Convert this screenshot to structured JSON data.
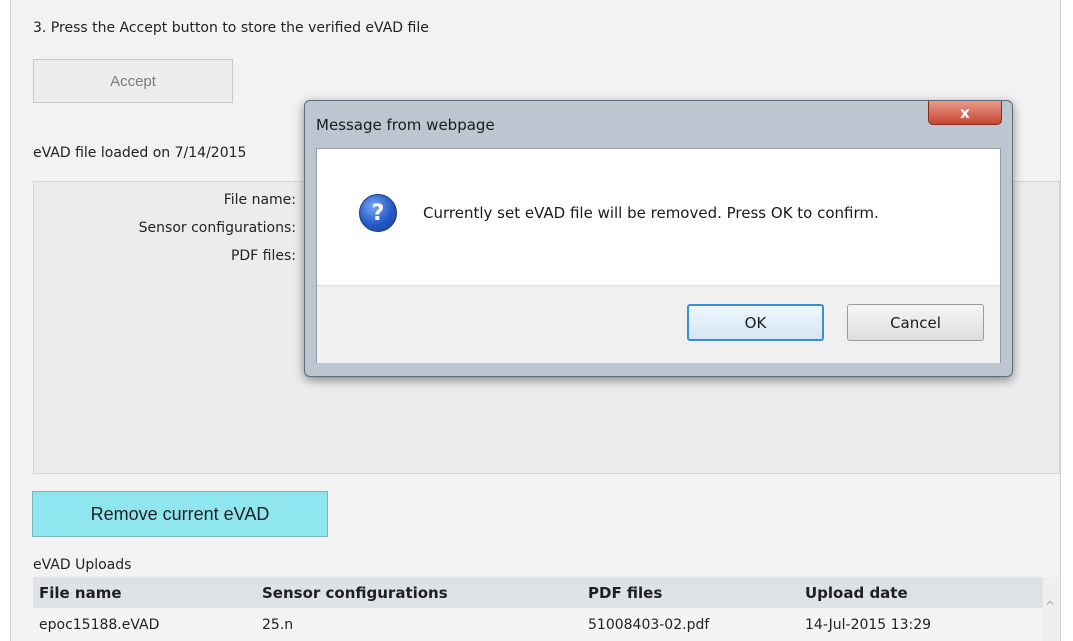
{
  "page": {
    "step_instruction": "3. Press the Accept button to store the verified eVAD file",
    "accept_label": "Accept",
    "loaded_text": "eVAD file loaded on 7/14/2015",
    "fields": {
      "file_name_label": "File name:",
      "sensor_configurations_label": "Sensor configurations:",
      "pdf_files_label": "PDF files:"
    },
    "remove_label": "Remove current eVAD",
    "uploads_title": "eVAD Uploads"
  },
  "uploads_table": {
    "columns": [
      "File name",
      "Sensor configurations",
      "PDF files",
      "Upload date"
    ],
    "rows": [
      [
        "epoc15188.eVAD",
        "25.n",
        "51008403-02.pdf",
        "14-Jul-2015 13:29"
      ]
    ]
  },
  "dialog": {
    "title": "Message from webpage",
    "close_glyph": "x",
    "question_glyph": "?",
    "message": "Currently set eVAD file will be removed. Press OK to confirm.",
    "ok_label": "OK",
    "cancel_label": "Cancel"
  },
  "colors": {
    "remove_button": "#8fe6ef",
    "close_button": "#c54632",
    "ok_focus_border": "#3c8fd6",
    "question_icon": "#2459c8"
  },
  "icons": {
    "dialog_icon": "question-icon",
    "close": "close-icon",
    "scroll": "scroll-up-arrow-icon"
  }
}
